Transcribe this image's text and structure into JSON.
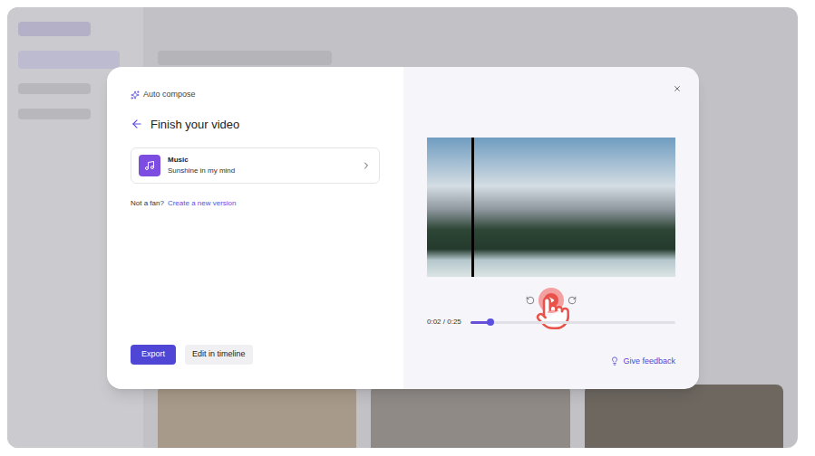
{
  "dialog": {
    "label": "Auto compose",
    "title": "Finish your video"
  },
  "music": {
    "label": "Music",
    "track": "Sunshine in my mind"
  },
  "prompt": {
    "text": "Not a fan?",
    "link": "Create a new version"
  },
  "buttons": [
    {
      "label": "Export",
      "primary": true
    },
    {
      "label": "Edit in timeline",
      "primary": false
    }
  ],
  "player": {
    "time": "0:02 / 0:25",
    "level": 0.1,
    "highlighted": true
  },
  "feedback": "Give feedback"
}
